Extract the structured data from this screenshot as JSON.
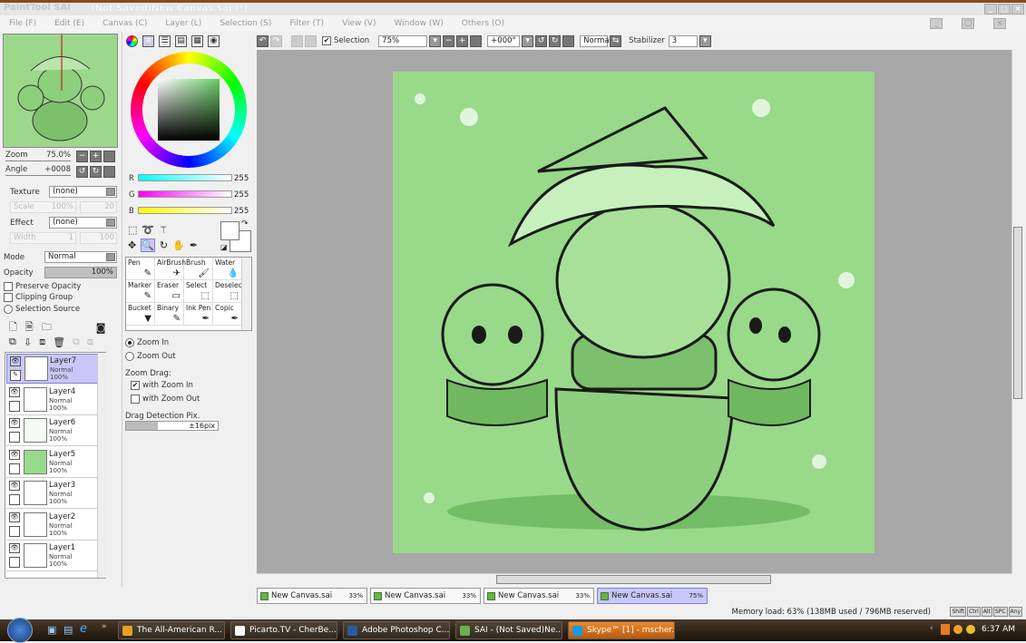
{
  "app": {
    "logo": "PaintTool SAI",
    "title": "(Not Saved)New Canvas.sai (*)"
  },
  "menu": [
    "File (F)",
    "Edit (E)",
    "Canvas (C)",
    "Layer (L)",
    "Selection (S)",
    "Filter (T)",
    "View (V)",
    "Window (W)",
    "Others (O)"
  ],
  "navigator": {
    "zoom_label": "Zoom",
    "zoom_value": "75.0%",
    "angle_label": "Angle",
    "angle_value": "+0008"
  },
  "brush_settings": {
    "texture_label": "Texture",
    "texture_value": "(none)",
    "scale_label": "Scale",
    "scale_value": "100%",
    "scale_amount": "20",
    "effect_label": "Effect",
    "effect_value": "(none)",
    "width_label": "Width",
    "width_value": "1",
    "width_amount": "100"
  },
  "layer_props": {
    "mode_label": "Mode",
    "mode_value": "Normal",
    "opacity_label": "Opacity",
    "opacity_value": "100%",
    "preserve_opacity": "Preserve Opacity",
    "clipping_group": "Clipping Group",
    "selection_source": "Selection Source"
  },
  "layers": [
    {
      "name": "Layer7",
      "mode": "Normal",
      "opacity": "100%",
      "thumb": "#ffffff",
      "active": true
    },
    {
      "name": "Layer4",
      "mode": "Normal",
      "opacity": "100%",
      "thumb": "#ffffff"
    },
    {
      "name": "Layer6",
      "mode": "Normal",
      "opacity": "100%",
      "thumb": "#f4fbf2"
    },
    {
      "name": "Layer5",
      "mode": "Normal",
      "opacity": "100%",
      "thumb": "#99d98a"
    },
    {
      "name": "Layer3",
      "mode": "Normal",
      "opacity": "100%",
      "thumb": "#ffffff"
    },
    {
      "name": "Layer2",
      "mode": "Normal",
      "opacity": "100%",
      "thumb": "#ffffff"
    },
    {
      "name": "Layer1",
      "mode": "Normal",
      "opacity": "100%",
      "thumb": "#ffffff"
    }
  ],
  "color": {
    "r_label": "R",
    "r": "255",
    "g_label": "G",
    "g": "255",
    "b_label": "B",
    "b": "255"
  },
  "tools": [
    {
      "name": "Pen",
      "icon": "✎"
    },
    {
      "name": "AirBrush",
      "icon": "✈"
    },
    {
      "name": "Brush",
      "icon": "🖌"
    },
    {
      "name": "Water",
      "icon": "💧"
    },
    {
      "name": "Marker",
      "icon": "✎"
    },
    {
      "name": "Eraser",
      "icon": "▭"
    },
    {
      "name": "Select",
      "icon": "⬚"
    },
    {
      "name": "Deselect",
      "icon": "⬚"
    },
    {
      "name": "Bucket",
      "icon": "▼"
    },
    {
      "name": "Binary",
      "icon": "✎"
    },
    {
      "name": "Ink Pen",
      "icon": "✒"
    },
    {
      "name": "Copic",
      "icon": "✒"
    }
  ],
  "zoom_tool": {
    "zoom_in": "Zoom In",
    "zoom_out": "Zoom Out",
    "drag_label": "Zoom Drag:",
    "with_zoom_in": "with Zoom In",
    "with_zoom_out": "with Zoom Out",
    "detect_label": "Drag Detection Pix.",
    "detect_value": "±16pix",
    "detect_fraction": 0.35
  },
  "toolbar": {
    "selection_label": "Selection",
    "zoom": "75%",
    "angle": "+000°",
    "blend": "Normal",
    "stabilizer_label": "Stabilizer",
    "stabilizer": "3"
  },
  "tabs": [
    {
      "name": "New Canvas.sai",
      "zoom": "33%"
    },
    {
      "name": "New Canvas.sai",
      "zoom": "33%"
    },
    {
      "name": "New Canvas.sai",
      "zoom": "33%"
    },
    {
      "name": "New Canvas.sai",
      "zoom": "75%",
      "active": true
    }
  ],
  "status": {
    "memory": "Memory load: 63% (138MB used / 796MB reserved)",
    "keys": [
      "Shift",
      "Ctrl",
      "Alt",
      "SPC",
      "Any"
    ]
  },
  "taskbar": {
    "items": [
      {
        "label": "The All-American R...",
        "color": "#e8a020"
      },
      {
        "label": "Picarto.TV - CherBe...",
        "color": "#ffffff"
      },
      {
        "label": "Adobe Photoshop C...",
        "color": "#2a5aa0"
      },
      {
        "label": "SAI - (Not Saved)Ne...",
        "color": "#6ab04c"
      },
      {
        "label": "Skype™ [1] - mscher...",
        "color": "#1a9ae0",
        "active": true
      }
    ],
    "time": "6:37 AM"
  },
  "colors": {
    "canvas_bg": "#99d98a",
    "workspace": "#a8a8a8",
    "active": "#c8c8f8"
  }
}
